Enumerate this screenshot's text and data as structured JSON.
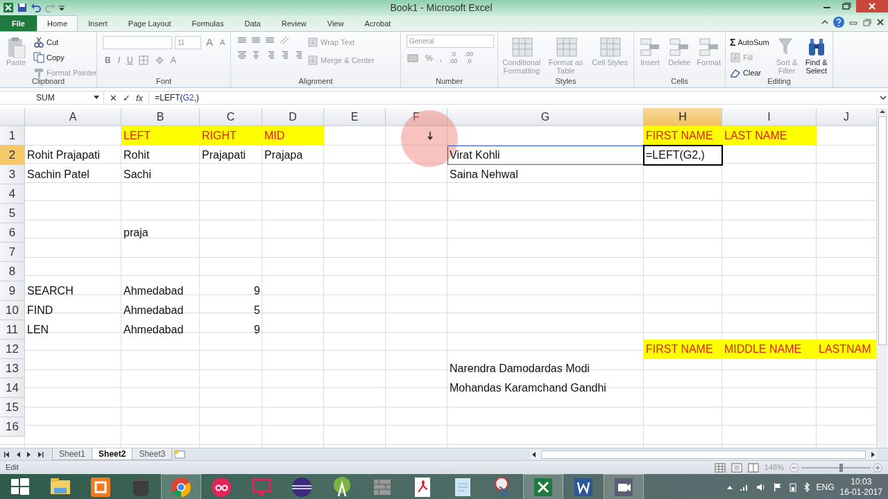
{
  "window": {
    "title": "Book1 - Microsoft Excel"
  },
  "ribbon_tabs": [
    {
      "label": "File",
      "kind": "file",
      "selected": false
    },
    {
      "label": "Home",
      "kind": "tab",
      "selected": true
    },
    {
      "label": "Insert",
      "kind": "tab",
      "selected": false
    },
    {
      "label": "Page Layout",
      "kind": "tab",
      "selected": false
    },
    {
      "label": "Formulas",
      "kind": "tab",
      "selected": false
    },
    {
      "label": "Data",
      "kind": "tab",
      "selected": false
    },
    {
      "label": "Review",
      "kind": "tab",
      "selected": false
    },
    {
      "label": "View",
      "kind": "tab",
      "selected": false
    },
    {
      "label": "Acrobat",
      "kind": "tab",
      "selected": false
    }
  ],
  "ribbon_groups": [
    {
      "kind": "clipboard",
      "label": "Clipboard",
      "items": [
        {
          "label": "Paste",
          "disabled": true
        },
        {
          "label": "Cut",
          "disabled": false
        },
        {
          "label": "Copy",
          "disabled": false
        },
        {
          "label": "Format Painter",
          "disabled": true
        }
      ]
    },
    {
      "kind": "font",
      "label": "Font",
      "font_size": "11",
      "grow": "A",
      "shrink": "A",
      "buttons": [
        "B",
        "I",
        "U",
        "A"
      ]
    },
    {
      "kind": "alignment",
      "label": "Alignment",
      "items": [
        {
          "label": "Wrap Text",
          "disabled": true
        },
        {
          "label": "Merge & Center",
          "disabled": true
        }
      ]
    },
    {
      "kind": "number",
      "label": "Number",
      "format": "General",
      "symbols": [
        "%",
        ","
      ],
      "decimals": [
        {
          "top": ".0",
          "bottom": ".00"
        },
        {
          "top": ".00",
          "bottom": ".0"
        }
      ]
    },
    {
      "kind": "styles",
      "label": "Styles",
      "items": [
        {
          "label": "Conditional Formatting",
          "disabled": true
        },
        {
          "label": "Format as Table",
          "disabled": true
        },
        {
          "label": "Cell Styles",
          "disabled": true
        }
      ]
    },
    {
      "kind": "cells",
      "label": "Cells",
      "items": [
        {
          "label": "Insert",
          "disabled": true
        },
        {
          "label": "Delete",
          "disabled": true
        },
        {
          "label": "Format",
          "disabled": true
        }
      ]
    },
    {
      "kind": "editing",
      "label": "Editing",
      "sigma": "Σ",
      "items": [
        {
          "label": "AutoSum",
          "disabled": false
        },
        {
          "label": "Fill",
          "disabled": true
        },
        {
          "label": "Clear",
          "disabled": false
        },
        {
          "label": "Sort & Filter",
          "disabled": true
        },
        {
          "label": "Find & Select",
          "disabled": false
        }
      ]
    }
  ],
  "formula_bar": {
    "name_box": "SUM",
    "buttons": [
      "✕",
      "✓",
      "fx"
    ],
    "formula": [
      {
        "text": "=LEFT(",
        "kind": "plain"
      },
      {
        "text": "G2",
        "kind": "reference"
      },
      {
        "text": ",)",
        "kind": "plain"
      }
    ]
  },
  "columns": [
    {
      "label": "A",
      "selected": false
    },
    {
      "label": "B",
      "selected": false
    },
    {
      "label": "C",
      "selected": false
    },
    {
      "label": "D",
      "selected": false
    },
    {
      "label": "E",
      "selected": false
    },
    {
      "label": "F",
      "selected": false
    },
    {
      "label": "G",
      "selected": false
    },
    {
      "label": "H",
      "selected": true
    },
    {
      "label": "I",
      "selected": false
    },
    {
      "label": "J",
      "selected": false
    }
  ],
  "rows": [
    {
      "header": "1",
      "selected": false,
      "cells": [
        {},
        {
          "text": "LEFT",
          "highlight": true
        },
        {
          "text": "RIGHT",
          "highlight": true
        },
        {
          "text": "MID",
          "highlight": true
        },
        {},
        {},
        {},
        {
          "text": "FIRST NAME",
          "highlight": true
        },
        {
          "text": "LAST NAME",
          "highlight": true
        },
        {}
      ]
    },
    {
      "header": "2",
      "selected": true,
      "cells": [
        {
          "text": "Rohit Prajapati"
        },
        {
          "text": "Rohit"
        },
        {
          "text": "Prajapati"
        },
        {
          "text": "Prajapa"
        },
        {},
        {},
        {
          "text": "Virat Kohli",
          "referenced": true
        },
        {
          "text": "=LEFT(G2,)",
          "editing": true
        },
        {},
        {}
      ]
    },
    {
      "header": "3",
      "selected": false,
      "cells": [
        {
          "text": "Sachin Patel"
        },
        {
          "text": "Sachi"
        },
        {},
        {},
        {},
        {},
        {
          "text": "Saina Nehwal"
        },
        {},
        {},
        {}
      ]
    },
    {
      "header": "4",
      "selected": false,
      "cells": [
        {},
        {},
        {},
        {},
        {},
        {},
        {},
        {},
        {},
        {}
      ]
    },
    {
      "header": "5",
      "selected": false,
      "cells": [
        {},
        {},
        {},
        {},
        {},
        {},
        {},
        {},
        {},
        {}
      ]
    },
    {
      "header": "6",
      "selected": false,
      "cells": [
        {},
        {
          "text": "praja"
        },
        {},
        {},
        {},
        {},
        {},
        {},
        {},
        {}
      ]
    },
    {
      "header": "7",
      "selected": false,
      "cells": [
        {},
        {},
        {},
        {},
        {},
        {},
        {},
        {},
        {},
        {}
      ]
    },
    {
      "header": "8",
      "selected": false,
      "cells": [
        {},
        {},
        {},
        {},
        {},
        {},
        {},
        {},
        {},
        {}
      ]
    },
    {
      "header": "9",
      "selected": false,
      "cells": [
        {
          "text": "SEARCH"
        },
        {
          "text": "Ahmedabad"
        },
        {
          "text": "9",
          "kind": "number"
        },
        {},
        {},
        {},
        {},
        {},
        {},
        {}
      ]
    },
    {
      "header": "10",
      "selected": false,
      "cells": [
        {
          "text": "FIND"
        },
        {
          "text": "Ahmedabad"
        },
        {
          "text": "5",
          "kind": "number"
        },
        {},
        {},
        {},
        {},
        {},
        {},
        {}
      ]
    },
    {
      "header": "11",
      "selected": false,
      "cells": [
        {
          "text": "LEN"
        },
        {
          "text": "Ahmedabad"
        },
        {
          "text": "9",
          "kind": "number"
        },
        {},
        {},
        {},
        {},
        {},
        {},
        {}
      ]
    },
    {
      "header": "12",
      "selected": false,
      "cells": [
        {},
        {},
        {},
        {},
        {},
        {},
        {},
        {
          "text": "FIRST NAME",
          "highlight": true
        },
        {
          "text": "MIDDLE NAME",
          "highlight": true
        },
        {
          "text": "LASTNAM",
          "highlight": true
        }
      ]
    },
    {
      "header": "13",
      "selected": false,
      "cells": [
        {},
        {},
        {},
        {},
        {},
        {},
        {
          "text": "Narendra Damodardas Modi"
        },
        {},
        {},
        {}
      ]
    },
    {
      "header": "14",
      "selected": false,
      "cells": [
        {},
        {},
        {},
        {},
        {},
        {},
        {
          "text": "Mohandas Karamchand Gandhi"
        },
        {},
        {},
        {}
      ]
    },
    {
      "header": "15",
      "selected": false,
      "cells": [
        {},
        {},
        {},
        {},
        {},
        {},
        {},
        {},
        {},
        {}
      ]
    },
    {
      "header": "16",
      "selected": false,
      "cells": [
        {},
        {},
        {},
        {},
        {},
        {},
        {},
        {},
        {},
        {}
      ]
    }
  ],
  "sheet_tabs": [
    {
      "label": "Sheet1",
      "selected": false
    },
    {
      "label": "Sheet2",
      "selected": true
    },
    {
      "label": "Sheet3",
      "selected": false
    }
  ],
  "status_bar": {
    "mode": "Edit",
    "zoom": "148%",
    "zoom_slider": {
      "level": 0.58
    }
  },
  "taskbar": {
    "apps": [
      {
        "kind": "start",
        "active": false
      },
      {
        "kind": "folder",
        "active": false
      },
      {
        "kind": "xampp",
        "active": false
      },
      {
        "kind": "database",
        "active": false
      },
      {
        "kind": "chrome",
        "active": true
      },
      {
        "kind": "ring",
        "active": false
      },
      {
        "kind": "monitor",
        "active": false
      },
      {
        "kind": "eclipse",
        "active": false
      },
      {
        "kind": "android",
        "active": false
      },
      {
        "kind": "wall",
        "active": false
      },
      {
        "kind": "pdf",
        "active": false
      },
      {
        "kind": "notepad",
        "active": false
      },
      {
        "kind": "scissors",
        "active": false
      },
      {
        "kind": "excel",
        "active": true
      },
      {
        "kind": "word",
        "active": false
      },
      {
        "kind": "camera",
        "active": true
      }
    ],
    "language": "ENG",
    "time": "10:03",
    "date": "16-01-2017"
  }
}
